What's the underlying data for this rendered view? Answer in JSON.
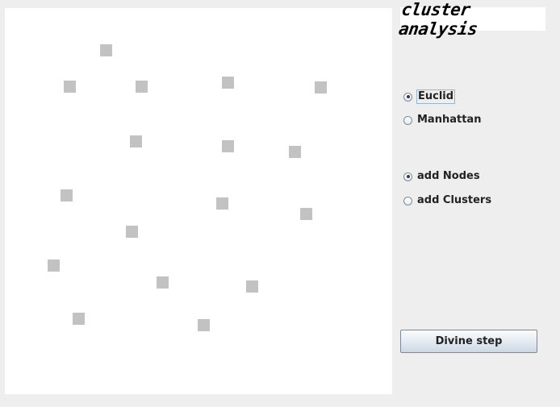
{
  "app": {
    "logo_text": "cluster analysis"
  },
  "metric": {
    "options": [
      {
        "label": "Euclid",
        "checked": true
      },
      {
        "label": "Manhattan",
        "checked": false
      }
    ]
  },
  "mode": {
    "options": [
      {
        "label": "add Nodes",
        "checked": true
      },
      {
        "label": "add Clusters",
        "checked": false
      }
    ]
  },
  "actions": {
    "step_label": "Divine step"
  },
  "colors": {
    "node": "#c2c2c2",
    "canvas": "#ffffff",
    "window": "#eeeeee"
  }
}
